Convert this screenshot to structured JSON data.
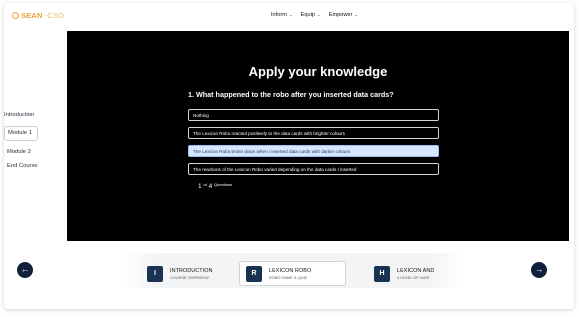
{
  "brand": {
    "name_primary": "SEAN",
    "name_secondary": "-CSO",
    "accent_color": "#e8a33a"
  },
  "nav": {
    "items": [
      {
        "label": "Inform",
        "icon": "chevron-down-icon"
      },
      {
        "label": "Equip",
        "icon": "chevron-down-icon"
      },
      {
        "label": "Empower",
        "icon": "chevron-down-icon"
      }
    ]
  },
  "sidebar": {
    "items": [
      {
        "label": "Introduction"
      },
      {
        "label": "Module 1",
        "active": true
      },
      {
        "label": "Module 2"
      },
      {
        "label": "End Course"
      }
    ]
  },
  "quiz": {
    "title": "Apply your knowledge",
    "question": "1. What happened to the robo after you inserted data cards?",
    "answers": [
      {
        "label": "Nothing",
        "selected": false
      },
      {
        "label": "The Lexicon Robo reacted positively to the data cards with brighter colours",
        "selected": false
      },
      {
        "label": "The Lexicon Robo broke down when I inserted data cards with darker colours",
        "selected": true
      },
      {
        "label": "The reactions of the Lexicon Robo varied depending on the data cards I inserted",
        "selected": false
      }
    ],
    "progress": {
      "current": "1",
      "of": "of",
      "total": "4",
      "suffix": "Questions"
    }
  },
  "carousel": {
    "prev_icon": "arrow-left-icon",
    "next_icon": "arrow-right-icon",
    "cards": [
      {
        "letter": "I",
        "title": "INTRODUCTION",
        "subtitle": "COURSE OVERVIEW"
      },
      {
        "letter": "R",
        "title": "LEXICON ROBO",
        "subtitle": "ROBO GAME & QUIZ",
        "current": true
      },
      {
        "letter": "H",
        "title": "LEXICON AND",
        "subtitle": "4 LEVEL OF HATE"
      }
    ]
  }
}
